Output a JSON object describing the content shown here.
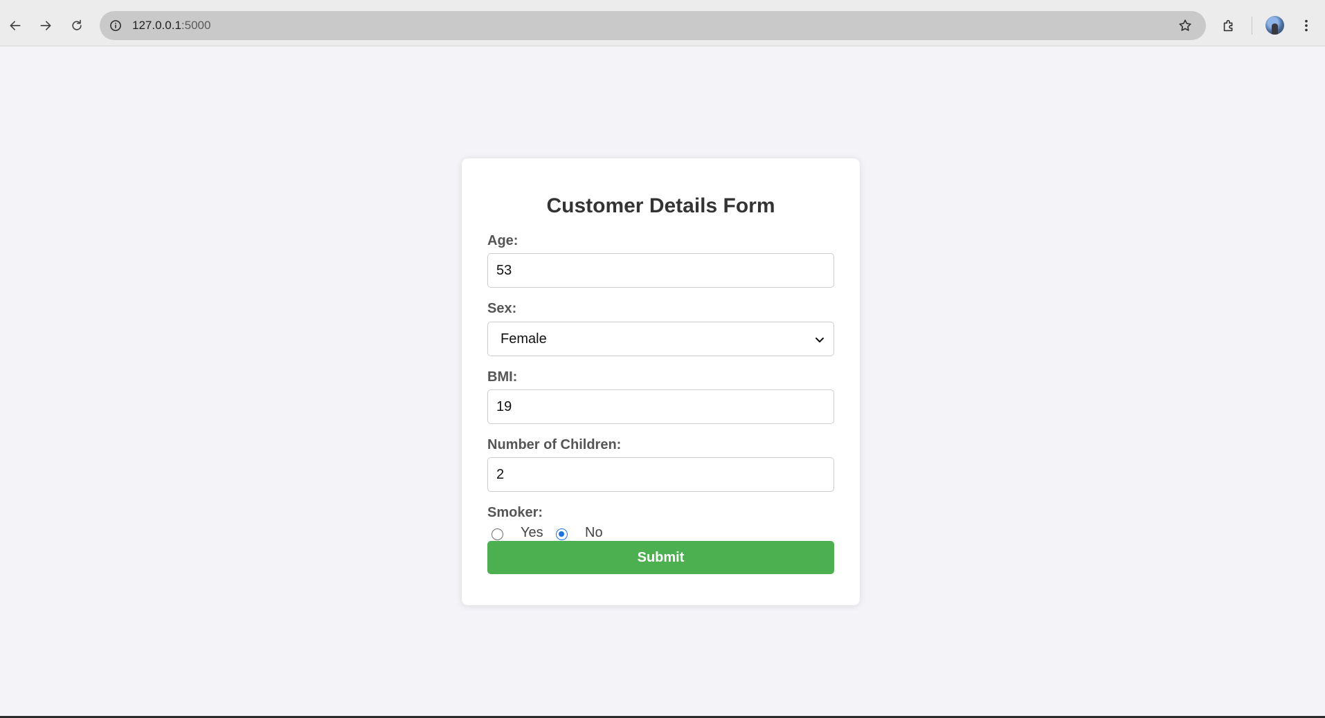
{
  "browser": {
    "url_host": "127.0.0.1",
    "url_port": ":5000",
    "icons": [
      "back-arrow-icon",
      "forward-arrow-icon",
      "reload-icon",
      "site-info-icon",
      "bookmark-star-icon",
      "extensions-icon",
      "profile-avatar",
      "kebab-menu-icon"
    ]
  },
  "form": {
    "title": "Customer Details Form",
    "age_label": "Age:",
    "age_value": "53",
    "sex_label": "Sex:",
    "sex_value": "Female",
    "bmi_label": "BMI:",
    "bmi_value": "19",
    "children_label": "Number of Children:",
    "children_value": "2",
    "smoker_label": "Smoker:",
    "smoker_yes": "Yes",
    "smoker_no": "No",
    "smoker_selected": "No",
    "submit_label": "Submit"
  },
  "colors": {
    "submit_bg": "#4caf50",
    "radio_accent": "#1a73e8",
    "page_bg": "#f3f3f8"
  }
}
